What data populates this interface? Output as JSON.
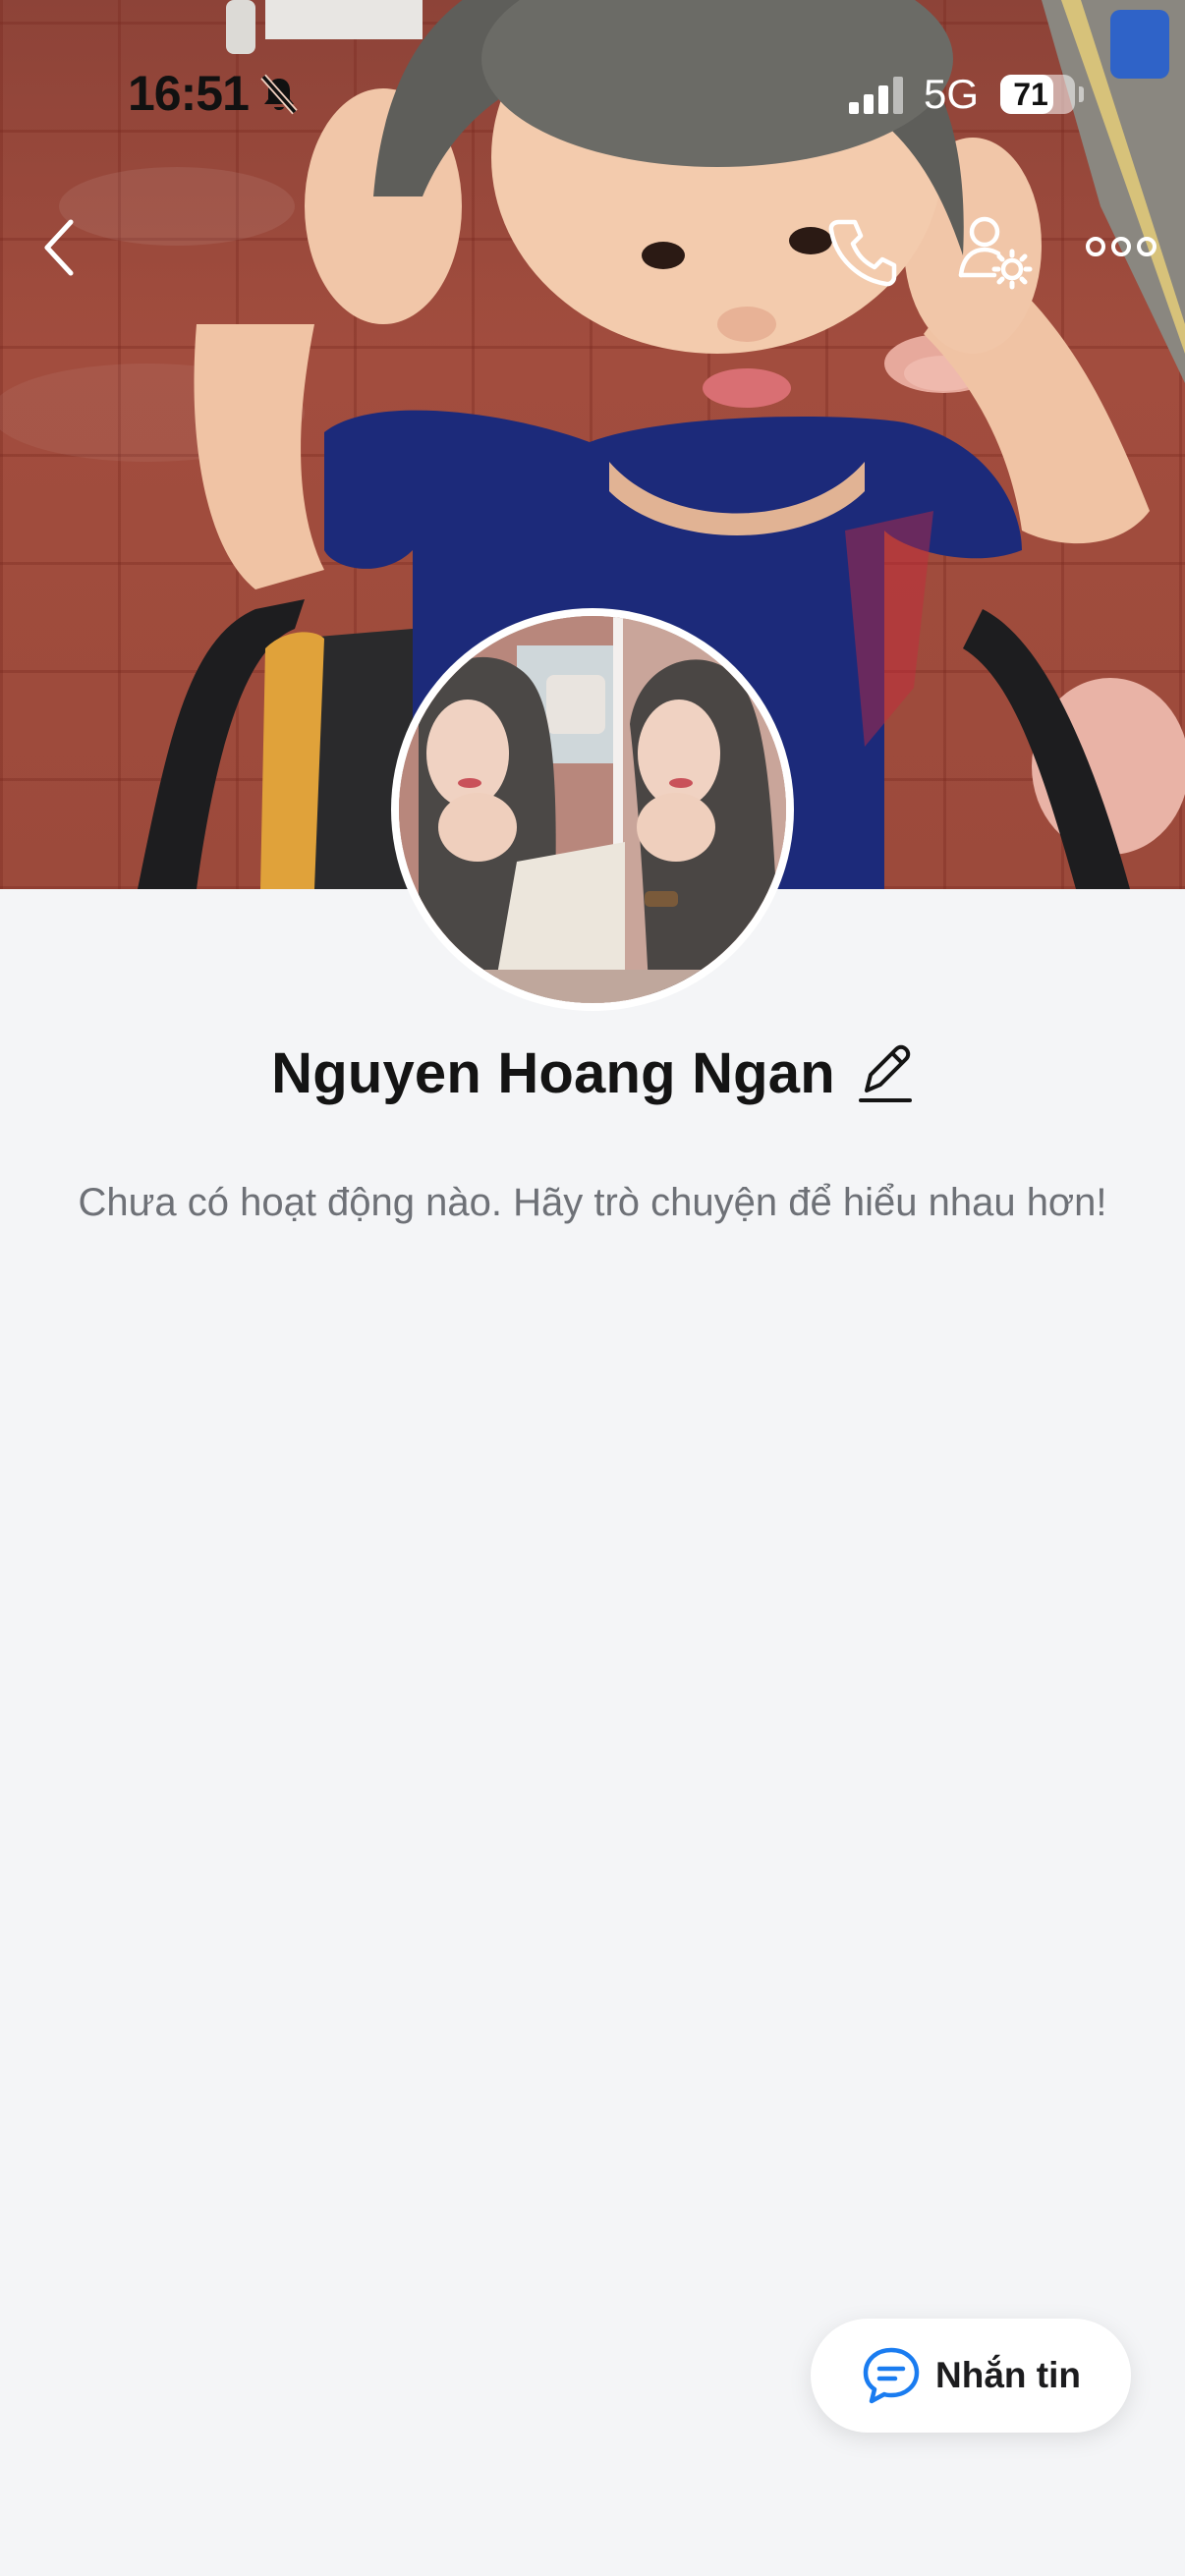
{
  "status_bar": {
    "time": "16:51",
    "network": "5G",
    "battery_level": "71",
    "battery_fraction": 0.71
  },
  "nav": {
    "back_icon": "chevron-left-icon",
    "call_icon": "phone-icon",
    "profile_settings_icon": "user-gear-icon",
    "more_icon": "more-dots-icon"
  },
  "profile": {
    "display_name": "Nguyen Hoang Ngan",
    "edit_icon": "pencil-icon",
    "empty_activity_text": "Chưa có hoạt động nào. Hãy trò chuyện để hiểu nhau hơn!"
  },
  "message_button": {
    "label": "Nhắn tin",
    "icon": "chat-bubble-icon",
    "accent_color": "#1a7cf0"
  },
  "colors": {
    "background": "#f4f5f7",
    "name_text": "#141414",
    "secondary_text": "#6e7177"
  }
}
